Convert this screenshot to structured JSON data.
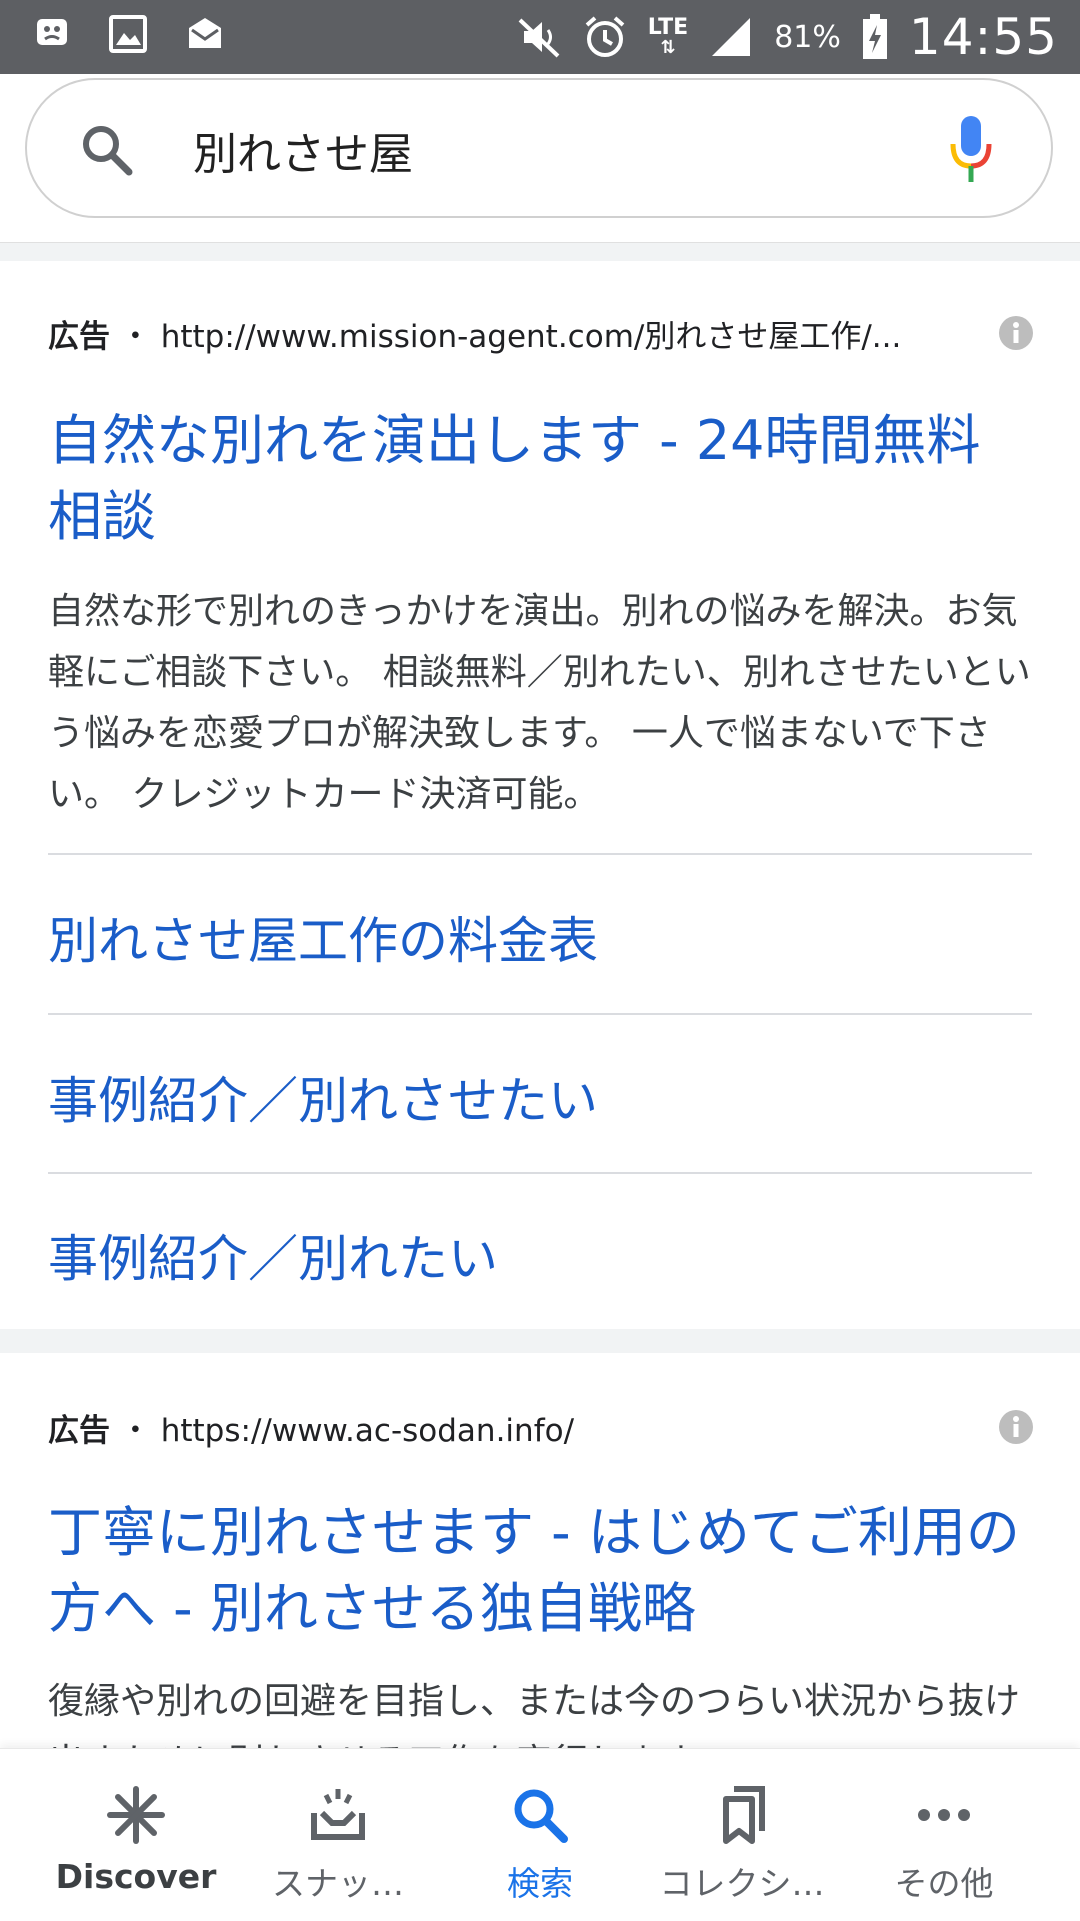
{
  "status_bar": {
    "battery_percent": "81%",
    "time": "14:55",
    "network": "LTE",
    "icons": [
      "notification-icon",
      "gallery-icon",
      "mail-icon",
      "mute-icon",
      "alarm-icon",
      "lte-icon",
      "signal-icon",
      "battery-icon"
    ]
  },
  "search": {
    "query": "別れさせ屋",
    "icon": "search-icon",
    "mic_icon": "mic-icon"
  },
  "ads": [
    {
      "label": "広告",
      "separator": "・",
      "url": "http://www.mission-agent.com/別れさせ屋工作/...",
      "title": "自然な別れを演出します - 24時間無料相談",
      "description": "自然な形で別れのきっかけを演出。別れの悩みを解決。お気軽にご相談下さい。 相談無料／別れたい、別れさせたいという悩みを恋愛プロが解決致します。 一人で悩まないで下さい。 クレジットカード決済可能。",
      "sitelinks": [
        "別れさせ屋工作の料金表",
        "事例紹介／別れさせたい",
        "事例紹介／別れたい"
      ]
    },
    {
      "label": "広告",
      "separator": "・",
      "url": "https://www.ac-sodan.info/",
      "title": "丁寧に別れさせます - はじめてご利用の方へ - 別れさせる独自戦略",
      "description": "復縁や別れの回避を目指し、または今のつらい状況から抜け出すために別れさせる工作を実行します。"
    }
  ],
  "bottom_nav": {
    "items": [
      {
        "label": "Discover",
        "icon": "discover-icon"
      },
      {
        "label": "スナッ…",
        "icon": "snapshot-icon"
      },
      {
        "label": "検索",
        "icon": "search-icon",
        "active": true
      },
      {
        "label": "コレクシ…",
        "icon": "collections-icon"
      },
      {
        "label": "その他",
        "icon": "more-icon"
      }
    ]
  },
  "colors": {
    "status_bar": "#5d5f63",
    "link_blue": "#1a5dc8",
    "active_blue": "#1a73e8",
    "text_dark": "#202124",
    "divider": "#dadce0"
  }
}
